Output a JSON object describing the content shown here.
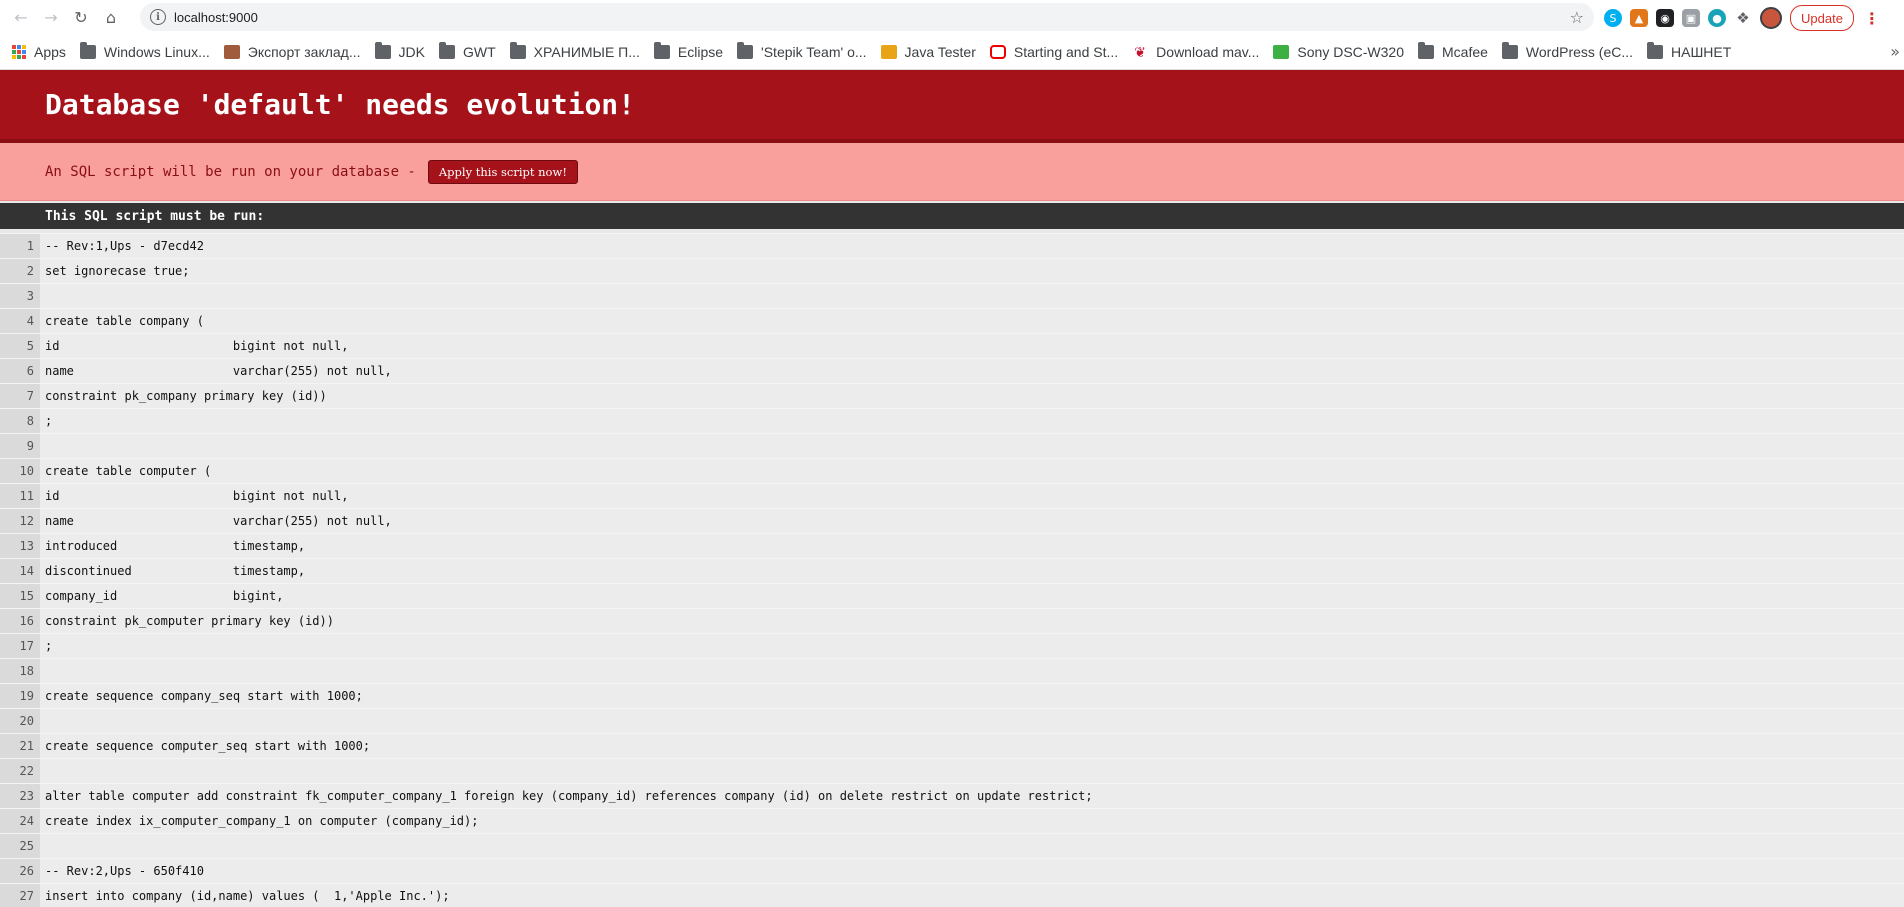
{
  "browser": {
    "url": "localhost:9000",
    "update_label": "Update"
  },
  "bookmarks": [
    {
      "label": "Apps",
      "icon": "apps-grid-icon"
    },
    {
      "label": "Windows Linux...",
      "icon": "folder-icon"
    },
    {
      "label": "Экспорт заклад...",
      "icon": "bookmark-export-icon"
    },
    {
      "label": "JDK",
      "icon": "folder-icon"
    },
    {
      "label": "GWT",
      "icon": "folder-icon"
    },
    {
      "label": "ХРАНИМЫЕ П...",
      "icon": "folder-icon"
    },
    {
      "label": "Eclipse",
      "icon": "folder-icon"
    },
    {
      "label": "'Stepik Team' o...",
      "icon": "folder-icon"
    },
    {
      "label": "Java Tester",
      "icon": "java-tester-icon"
    },
    {
      "label": "Starting and St...",
      "icon": "oracle-icon"
    },
    {
      "label": "Download mav...",
      "icon": "maven-feather-icon"
    },
    {
      "label": "Sony DSC-W320",
      "icon": "sony-icon"
    },
    {
      "label": "Mcafee",
      "icon": "folder-icon"
    },
    {
      "label": "WordPress (eC...",
      "icon": "folder-icon"
    },
    {
      "label": "НАШНЕТ",
      "icon": "folder-icon"
    }
  ],
  "page": {
    "title": "Database 'default' needs evolution!",
    "notice": "An SQL script will be run on your database -",
    "apply_button": "Apply this script now!",
    "script_header": "This SQL script must be run:"
  },
  "script_lines": [
    {
      "n": "1",
      "text": "-- Rev:1,Ups - d7ecd42"
    },
    {
      "n": "2",
      "text": "set ignorecase true;"
    },
    {
      "n": "3",
      "text": ""
    },
    {
      "n": "4",
      "text": "create table company ("
    },
    {
      "n": "5",
      "text": "id                        bigint not null,"
    },
    {
      "n": "6",
      "text": "name                      varchar(255) not null,"
    },
    {
      "n": "7",
      "text": "constraint pk_company primary key (id))"
    },
    {
      "n": "8",
      "text": ";"
    },
    {
      "n": "9",
      "text": ""
    },
    {
      "n": "10",
      "text": "create table computer ("
    },
    {
      "n": "11",
      "text": "id                        bigint not null,"
    },
    {
      "n": "12",
      "text": "name                      varchar(255) not null,"
    },
    {
      "n": "13",
      "text": "introduced                timestamp,"
    },
    {
      "n": "14",
      "text": "discontinued              timestamp,"
    },
    {
      "n": "15",
      "text": "company_id                bigint,"
    },
    {
      "n": "16",
      "text": "constraint pk_computer primary key (id))"
    },
    {
      "n": "17",
      "text": ";"
    },
    {
      "n": "18",
      "text": ""
    },
    {
      "n": "19",
      "text": "create sequence company_seq start with 1000;"
    },
    {
      "n": "20",
      "text": ""
    },
    {
      "n": "21",
      "text": "create sequence computer_seq start with 1000;"
    },
    {
      "n": "22",
      "text": ""
    },
    {
      "n": "23",
      "text": "alter table computer add constraint fk_computer_company_1 foreign key (company_id) references company (id) on delete restrict on update restrict;"
    },
    {
      "n": "24",
      "text": "create index ix_computer_company_1 on computer (company_id);"
    },
    {
      "n": "25",
      "text": ""
    },
    {
      "n": "26",
      "text": "-- Rev:2,Ups - 650f410"
    },
    {
      "n": "27",
      "text": "insert into company (id,name) values (  1,'Apple Inc.');"
    }
  ]
}
